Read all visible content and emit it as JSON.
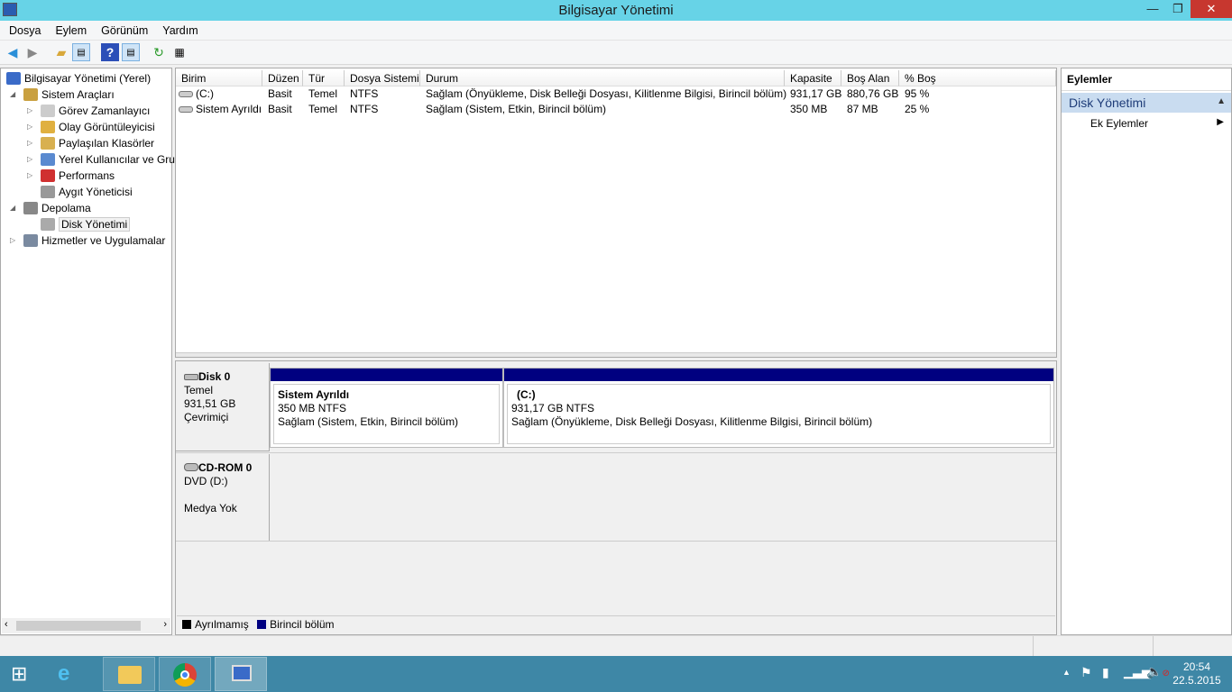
{
  "window": {
    "title": "Bilgisayar Yönetimi",
    "minimize": "—",
    "maximize": "❐",
    "close": "✕"
  },
  "menu": [
    "Dosya",
    "Eylem",
    "Görünüm",
    "Yardım"
  ],
  "tree": [
    {
      "label": "Bilgisayar Yönetimi (Yerel)",
      "level": 0,
      "icon": "computer-icon"
    },
    {
      "label": "Sistem Araçları",
      "level": 1,
      "icon": "tools-icon",
      "exp": "◢"
    },
    {
      "label": "Görev Zamanlayıcı",
      "level": 2,
      "icon": "clock-icon",
      "exp": "▷"
    },
    {
      "label": "Olay Görüntüleyicisi",
      "level": 2,
      "icon": "event-viewer-icon",
      "exp": "▷"
    },
    {
      "label": "Paylaşılan Klasörler",
      "level": 2,
      "icon": "shared-folder-icon",
      "exp": "▷"
    },
    {
      "label": "Yerel Kullanıcılar ve Gru",
      "level": 2,
      "icon": "users-icon",
      "exp": "▷"
    },
    {
      "label": "Performans",
      "level": 2,
      "icon": "performance-icon",
      "exp": "▷"
    },
    {
      "label": "Aygıt Yöneticisi",
      "level": 2,
      "icon": "device-manager-icon"
    },
    {
      "label": "Depolama",
      "level": 1,
      "icon": "storage-icon",
      "exp": "◢"
    },
    {
      "label": "Disk Yönetimi",
      "level": 2,
      "icon": "disk-icon",
      "selected": true
    },
    {
      "label": "Hizmetler ve Uygulamalar",
      "level": 1,
      "icon": "services-icon",
      "exp": "▷"
    }
  ],
  "table": {
    "columns": [
      "Birim",
      "Düzen",
      "Tür",
      "Dosya Sistemi",
      "Durum",
      "Kapasite",
      "Boş Alan",
      "% Boş"
    ],
    "rows": [
      [
        "(C:)",
        "Basit",
        "Temel",
        "NTFS",
        "Sağlam (Önyükleme, Disk Belleği Dosyası, Kilitlenme Bilgisi, Birincil bölüm)",
        "931,17 GB",
        "880,76 GB",
        "95 %"
      ],
      [
        "Sistem Ayrıldı",
        "Basit",
        "Temel",
        "NTFS",
        "Sağlam (Sistem, Etkin, Birincil bölüm)",
        "350 MB",
        "87 MB",
        "25 %"
      ]
    ]
  },
  "disks": [
    {
      "name": "Disk 0",
      "type": "Temel",
      "size": "931,51 GB",
      "status": "Çevrimiçi"
    },
    {
      "name": "CD-ROM 0",
      "type": "DVD (D:)",
      "size": "",
      "status": "Medya Yok"
    }
  ],
  "partitions": [
    {
      "name": "Sistem Ayrıldı",
      "size": "350 MB NTFS",
      "status": "Sağlam (Sistem, Etkin, Birincil bölüm)"
    },
    {
      "name": "(C:)",
      "size": "931,17 GB NTFS",
      "status": "Sağlam (Önyükleme, Disk Belleği Dosyası, Kilitlenme Bilgisi, Birincil bölüm)"
    }
  ],
  "legend": [
    {
      "label": "Ayrılmamış",
      "color": "#000000"
    },
    {
      "label": "Birincil bölüm",
      "color": "#000080"
    }
  ],
  "actions": {
    "title": "Eylemler",
    "section": "Disk Yönetimi",
    "item": "Ek Eylemler"
  },
  "clock": {
    "time": "20:54",
    "date": "22.5.2015"
  }
}
